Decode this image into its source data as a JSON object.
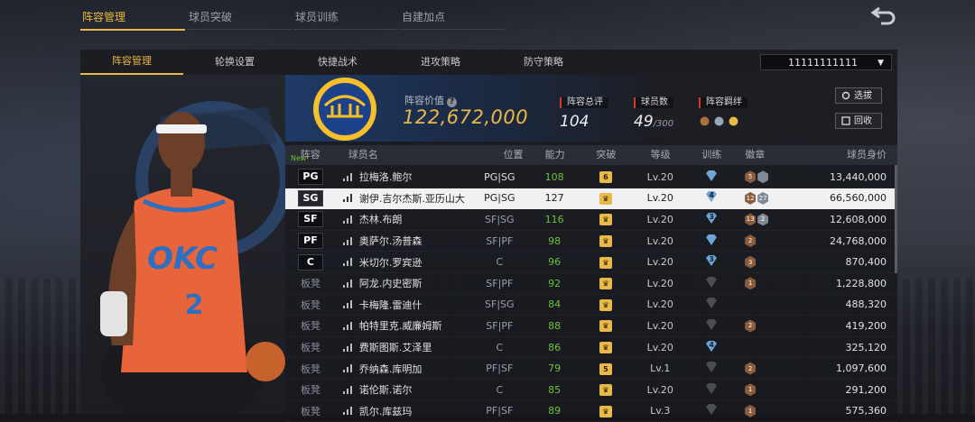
{
  "top_tabs": [
    {
      "label": "阵容管理",
      "active": true
    },
    {
      "label": "球员突破",
      "active": false
    },
    {
      "label": "球员训练",
      "active": false
    },
    {
      "label": "自建加点",
      "active": false
    }
  ],
  "sub_tabs": [
    {
      "label": "阵容管理",
      "active": true
    },
    {
      "label": "轮换设置",
      "active": false
    },
    {
      "label": "快捷战术",
      "active": false
    },
    {
      "label": "进攻策略",
      "active": false
    },
    {
      "label": "防守策略",
      "active": false
    }
  ],
  "lineup_select": {
    "value": "11111111111"
  },
  "summary": {
    "value_label": "阵容价值",
    "value": "122,672,000",
    "rating_label": "阵容总评",
    "rating": "104",
    "count_label": "球员数",
    "count": "49",
    "count_total": "/300",
    "fav_label": "阵容羁绊",
    "buttons": {
      "select": "选拔",
      "recycle": "回收"
    }
  },
  "table": {
    "headers": [
      "阵容",
      "球员名",
      "位置",
      "能力",
      "突破",
      "等级",
      "训练",
      "徽章",
      "球员身价"
    ],
    "rows": [
      {
        "lineup": "PG",
        "starter": true,
        "new": "New",
        "name": "拉梅洛.鲍尔",
        "pos": "PG|SG",
        "ability": "108",
        "break": "6",
        "grade": "Lv.20",
        "train": "blue",
        "badges": [
          "5",
          "s"
        ],
        "value": "13,440,000"
      },
      {
        "lineup": "SG",
        "starter": true,
        "name": "谢伊.吉尔杰斯.亚历山大",
        "pos": "PG|SG",
        "ability": "127",
        "break": "crown",
        "grade": "Lv.20",
        "train": "4",
        "badges": [
          "12",
          "27"
        ],
        "value": "66,560,000",
        "selected": true
      },
      {
        "lineup": "SF",
        "starter": true,
        "name": "杰林.布朗",
        "pos": "SF|SG",
        "ability": "116",
        "break": "crown",
        "grade": "Lv.20",
        "train": "3",
        "badges": [
          "13",
          "2"
        ],
        "value": "12,608,000"
      },
      {
        "lineup": "PF",
        "starter": true,
        "name": "奥萨尔.汤普森",
        "pos": "SF|PF",
        "ability": "98",
        "break": "crown",
        "grade": "Lv.20",
        "train": "blue",
        "badges": [
          "2"
        ],
        "value": "24,768,000"
      },
      {
        "lineup": "C",
        "starter": true,
        "name": "米切尔.罗宾逊",
        "pos": "C",
        "ability": "96",
        "break": "crown",
        "grade": "Lv.20",
        "train": "3",
        "badges": [
          "3"
        ],
        "value": "870,400"
      },
      {
        "lineup": "板凳",
        "starter": false,
        "name": "阿龙.内史密斯",
        "pos": "SF|PF",
        "ability": "92",
        "break": "crown",
        "grade": "Lv.20",
        "train": "grey",
        "badges": [
          "1"
        ],
        "value": "1,228,800"
      },
      {
        "lineup": "板凳",
        "starter": false,
        "name": "卡梅隆.雷迪什",
        "pos": "SF|SG",
        "ability": "84",
        "break": "crown",
        "grade": "Lv.20",
        "train": "grey",
        "badges": [],
        "value": "488,320"
      },
      {
        "lineup": "板凳",
        "starter": false,
        "name": "帕特里克.威廉姆斯",
        "pos": "SF|PF",
        "ability": "88",
        "break": "crown",
        "grade": "Lv.20",
        "train": "grey",
        "badges": [
          "2"
        ],
        "value": "419,200"
      },
      {
        "lineup": "板凳",
        "starter": false,
        "name": "费斯图斯.艾泽里",
        "pos": "C",
        "ability": "86",
        "break": "crown",
        "grade": "Lv.20",
        "train": "4",
        "badges": [],
        "value": "325,120"
      },
      {
        "lineup": "板凳",
        "starter": false,
        "name": "乔纳森.库明加",
        "pos": "PF|SF",
        "ability": "79",
        "break": "5",
        "grade": "Lv.1",
        "train": "grey",
        "badges": [
          "2"
        ],
        "value": "1,097,600"
      },
      {
        "lineup": "板凳",
        "starter": false,
        "name": "诺伦斯.诺尔",
        "pos": "C",
        "ability": "85",
        "break": "crown",
        "grade": "Lv.20",
        "train": "grey",
        "badges": [
          "1"
        ],
        "value": "291,200"
      },
      {
        "lineup": "板凳",
        "starter": false,
        "name": "凯尔.库兹玛",
        "pos": "PF|SF",
        "ability": "89",
        "break": "crown",
        "grade": "Lv.3",
        "train": "grey",
        "badges": [
          "1"
        ],
        "value": "575,360"
      }
    ]
  },
  "colors": {
    "accent": "#e8b949",
    "ability": "#6cc23a",
    "label_marker": "#d33a2c",
    "okc_orange": "#e8643a",
    "okc_blue": "#2f6fc0"
  }
}
